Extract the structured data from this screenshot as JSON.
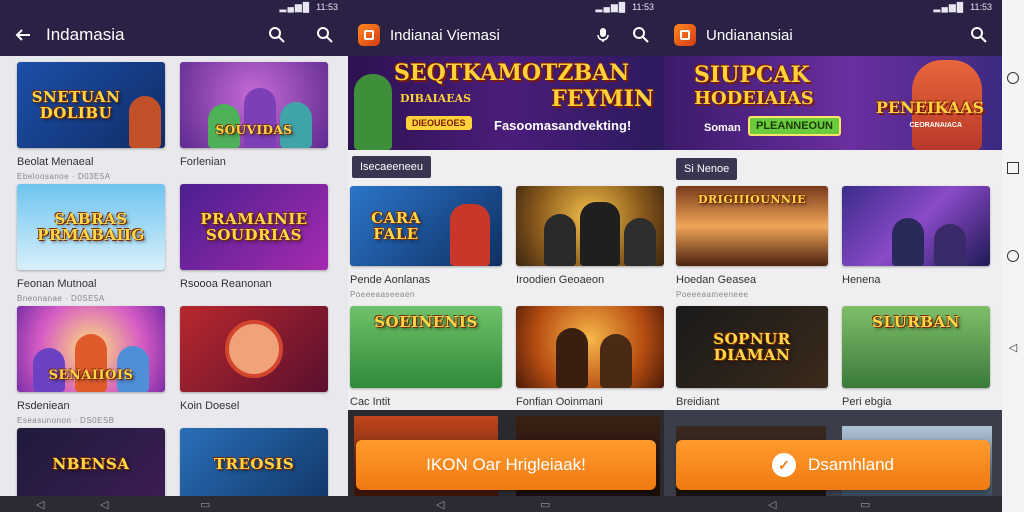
{
  "panel1": {
    "title": "Indamasia",
    "cards": [
      {
        "art": "SNETUAN DOLIBU",
        "name": "Beolat Menaeal",
        "sub": "Ebeloosanoe · D03E5A"
      },
      {
        "art": "SOUVIDAS",
        "name": "Forlenian",
        "sub": ""
      },
      {
        "art": "SABRAS PRMABAIIG",
        "name": "Feonan Mutnoal",
        "sub": "Bneonanae · D0SE5A"
      },
      {
        "art": "PRAMAINIE SOUDRIAS",
        "name": "Rsoooa Reanonan",
        "sub": ""
      },
      {
        "art": "SENAIIOIS",
        "name": "Rsdeniean",
        "sub": "Eseasunonon · DS0ESB"
      },
      {
        "art": "",
        "name": "Koin Doesel",
        "sub": ""
      },
      {
        "art": "NBENSA",
        "name": "",
        "sub": ""
      },
      {
        "art": "TREOSIS",
        "name": "",
        "sub": ""
      }
    ]
  },
  "panel2": {
    "title": "Indianai Viemasi",
    "banner_headline_1": "SEQTKAMOTZBAN",
    "banner_headline_2": "FEYMIN",
    "banner_tag": "DIBAIAEAS",
    "banner_badge": "DIEOUEOES",
    "banner_text": "Fasoomasandvekting!",
    "section_label": "Isecaeeneeu",
    "cards": [
      {
        "art": "CARA FALE",
        "name": "Pende Aonlanas",
        "sub": "Poeeeaaseeaen"
      },
      {
        "art": "",
        "name": "Iroodien Geoaeon",
        "sub": ""
      },
      {
        "art": "SOEINENIS",
        "name": "Cac Intit",
        "sub": ""
      },
      {
        "art": "",
        "name": "Fonfian Ooinmani",
        "sub": ""
      }
    ],
    "cta": "IKON Oar Hrigleiaak!"
  },
  "panel3": {
    "title": "Undianansiai",
    "banner_headline_1": "SIUPCAK",
    "banner_headline_2": "HODEIAIAS",
    "banner_side": "PENEIKAAS",
    "banner_side_sub": "CEORANAIACA",
    "banner_small": "Soman",
    "banner_button": "PLEANNEOUN",
    "section_label": "Si Nenoe",
    "cards": [
      {
        "art": "DRIGIIIOUNNIE",
        "name": "Hoedan Geasea",
        "sub": "Poeeeaameeneee"
      },
      {
        "art": "",
        "name": "Henena",
        "sub": ""
      },
      {
        "art": "SOPNUR DIAMAN",
        "name": "Breidiant",
        "sub": ""
      },
      {
        "art": "SLURBAN",
        "name": "Peri ebgia",
        "sub": ""
      }
    ],
    "cta": "Dsamhland"
  },
  "status": {
    "time": "11:53",
    "signal": "▂▄▆█"
  }
}
